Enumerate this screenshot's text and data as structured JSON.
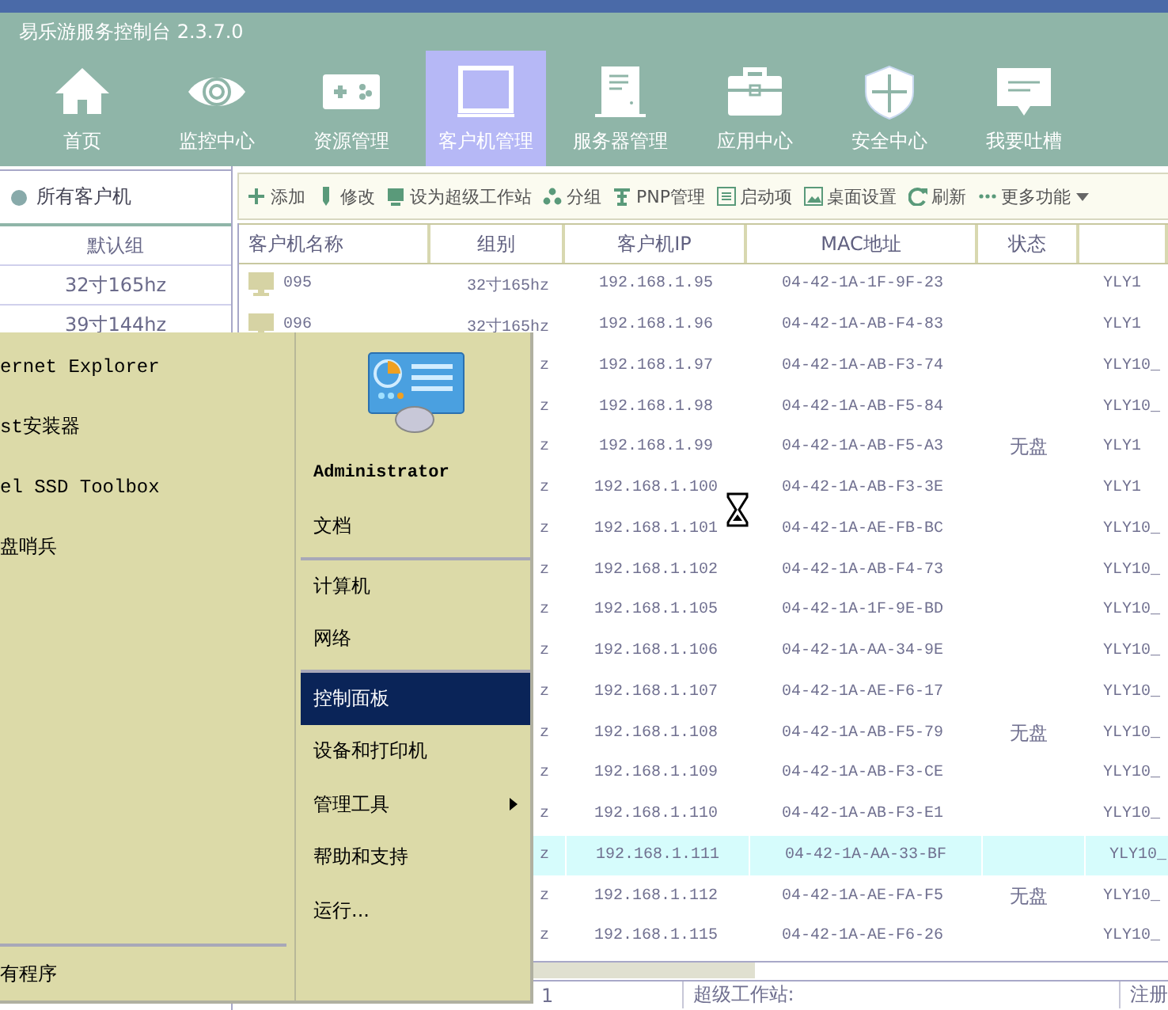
{
  "window": {
    "title": "易乐游服务控制台 2.3.7.0"
  },
  "nav": [
    {
      "kind": "home",
      "label": "首页",
      "selected": false
    },
    {
      "kind": "eye",
      "label": "监控中心",
      "selected": false
    },
    {
      "kind": "gamepad",
      "label": "资源管理",
      "selected": false
    },
    {
      "kind": "monitor",
      "label": "客户机管理",
      "selected": true
    },
    {
      "kind": "server",
      "label": "服务器管理",
      "selected": false
    },
    {
      "kind": "toolbox",
      "label": "应用中心",
      "selected": false
    },
    {
      "kind": "shield",
      "label": "安全中心",
      "selected": false
    },
    {
      "kind": "chat",
      "label": "我要吐槽",
      "selected": false
    }
  ],
  "sidebar": {
    "header": "所有客户机",
    "groups": [
      "默认组",
      "32寸165hz",
      "39寸144hz"
    ]
  },
  "toolbar": [
    {
      "kind": "add",
      "label": "添加"
    },
    {
      "kind": "edit",
      "label": "修改"
    },
    {
      "kind": "workstation",
      "label": "设为超级工作站"
    },
    {
      "kind": "group",
      "label": "分组"
    },
    {
      "kind": "pnp",
      "label": "PNP管理"
    },
    {
      "kind": "startup",
      "label": "启动项"
    },
    {
      "kind": "desktop",
      "label": "桌面设置"
    },
    {
      "kind": "refresh",
      "label": "刷新"
    },
    {
      "kind": "more",
      "label": "更多功能"
    }
  ],
  "table": {
    "columns": [
      "客户机名称",
      "组别",
      "客户机IP",
      "MAC地址",
      "状态"
    ],
    "rows": [
      {
        "name": "095",
        "group": "32寸165hz",
        "ip": "192.168.1.95",
        "mac": "04-42-1A-1F-9F-23",
        "column_6": "YLY1",
        "selected": false
      },
      {
        "name": "096",
        "group": "32寸165hz",
        "ip": "192.168.1.96",
        "mac": "04-42-1A-AB-F4-83",
        "column_6": "YLY1",
        "selected": false
      },
      {
        "group": "z",
        "ip": "192.168.1.97",
        "mac": "04-42-1A-AB-F3-74",
        "column_6": "YLY10_",
        "selected": false
      },
      {
        "group": "z",
        "ip": "192.168.1.98",
        "mac": "04-42-1A-AB-F5-84",
        "column_6": "YLY10_",
        "selected": false
      },
      {
        "group": "z",
        "ip": "192.168.1.99",
        "mac": "04-42-1A-AB-F5-A3",
        "status": "无盘",
        "column_6": "YLY1",
        "selected": false
      },
      {
        "group": "z",
        "ip": "192.168.1.100",
        "mac": "04-42-1A-AB-F3-3E",
        "column_6": "YLY1",
        "selected": false
      },
      {
        "group": "z",
        "ip": "192.168.1.101",
        "mac": "04-42-1A-AE-FB-BC",
        "column_6": "YLY10_",
        "selected": false
      },
      {
        "group": "z",
        "ip": "192.168.1.102",
        "mac": "04-42-1A-AB-F4-73",
        "column_6": "YLY10_",
        "selected": false
      },
      {
        "group": "z",
        "ip": "192.168.1.105",
        "mac": "04-42-1A-1F-9E-BD",
        "column_6": "YLY10_",
        "selected": false
      },
      {
        "group": "z",
        "ip": "192.168.1.106",
        "mac": "04-42-1A-AA-34-9E",
        "column_6": "YLY10_",
        "selected": false
      },
      {
        "group": "z",
        "ip": "192.168.1.107",
        "mac": "04-42-1A-AE-F6-17",
        "column_6": "YLY10_",
        "selected": false
      },
      {
        "group": "z",
        "ip": "192.168.1.108",
        "mac": "04-42-1A-AB-F5-79",
        "status": "无盘",
        "column_6": "YLY10_",
        "selected": false
      },
      {
        "group": "z",
        "ip": "192.168.1.109",
        "mac": "04-42-1A-AB-F3-CE",
        "column_6": "YLY10_",
        "selected": false
      },
      {
        "group": "z",
        "ip": "192.168.1.110",
        "mac": "04-42-1A-AB-F3-E1",
        "column_6": "YLY10_",
        "selected": false
      },
      {
        "group": "z",
        "ip": "192.168.1.111",
        "mac": "04-42-1A-AA-33-BF",
        "column_6": "YLY10_",
        "selected": true
      },
      {
        "group": "z",
        "ip": "192.168.1.112",
        "mac": "04-42-1A-AE-FA-F5",
        "status": "无盘",
        "column_6": "YLY10_",
        "selected": false
      },
      {
        "group": "z",
        "ip": "192.168.1.115",
        "mac": "04-42-1A-AE-F6-26",
        "column_6": "YLY10_",
        "selected": false
      }
    ]
  },
  "status_bar": [
    "1",
    "超级工作站:",
    "注册"
  ],
  "start_menu": {
    "programs": [
      "ernet Explorer",
      "st安装器",
      "el SSD Toolbox",
      "盘哨兵"
    ],
    "all_programs": "有程序",
    "user": "Administrator",
    "sections": [
      [
        {
          "label": "文档",
          "selected": false,
          "submenu": false
        }
      ],
      [
        {
          "label": "计算机",
          "selected": false,
          "submenu": false
        },
        {
          "label": "网络",
          "selected": false,
          "submenu": false
        }
      ],
      [
        {
          "label": "控制面板",
          "selected": true,
          "submenu": false
        },
        {
          "label": "设备和打印机",
          "selected": false,
          "submenu": false
        },
        {
          "label": "管理工具",
          "selected": false,
          "submenu": true
        },
        {
          "label": "帮助和支持",
          "selected": false,
          "submenu": false
        },
        {
          "label": "运行...",
          "selected": false,
          "submenu": false
        }
      ]
    ]
  }
}
